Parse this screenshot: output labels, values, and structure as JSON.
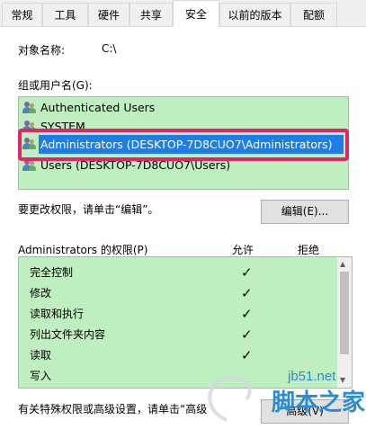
{
  "tabs": [
    {
      "label": "常规"
    },
    {
      "label": "工具"
    },
    {
      "label": "硬件"
    },
    {
      "label": "共享"
    },
    {
      "label": "安全",
      "active": true
    },
    {
      "label": "以前的版本"
    },
    {
      "label": "配额"
    }
  ],
  "object": {
    "label": "对象名称:",
    "value": "C:\\"
  },
  "groups": {
    "label": "组或用户名(G):",
    "items": [
      {
        "label": "Authenticated Users"
      },
      {
        "label": "SYSTEM"
      },
      {
        "label": "Administrators (DESKTOP-7D8CUO7\\Administrators)",
        "selected": true
      },
      {
        "label": "Users (DESKTOP-7D8CUO7\\Users)"
      }
    ]
  },
  "edit_hint": "要更改权限，请单击“编辑”。",
  "edit_button": "编辑(E)...",
  "permissions": {
    "header": "Administrators 的权限(P)",
    "allow_header": "允许",
    "deny_header": "拒绝",
    "rows": [
      {
        "label": "完全控制",
        "allow": "✓"
      },
      {
        "label": "修改",
        "allow": "✓"
      },
      {
        "label": "读取和执行",
        "allow": "✓"
      },
      {
        "label": "列出文件夹内容",
        "allow": "✓"
      },
      {
        "label": "读取",
        "allow": "✓"
      },
      {
        "label": "写入",
        "allow": ""
      }
    ]
  },
  "advanced": {
    "hint": "有关特殊权限或高级设置，请单击“高级",
    "button": "高级(V)"
  },
  "watermark": {
    "line1": "jb51.net",
    "line2": "脚本之家"
  },
  "colors": {
    "list_bg": "#bfeec0",
    "selection": "#1e7ee8",
    "highlight": "#e2246a"
  }
}
